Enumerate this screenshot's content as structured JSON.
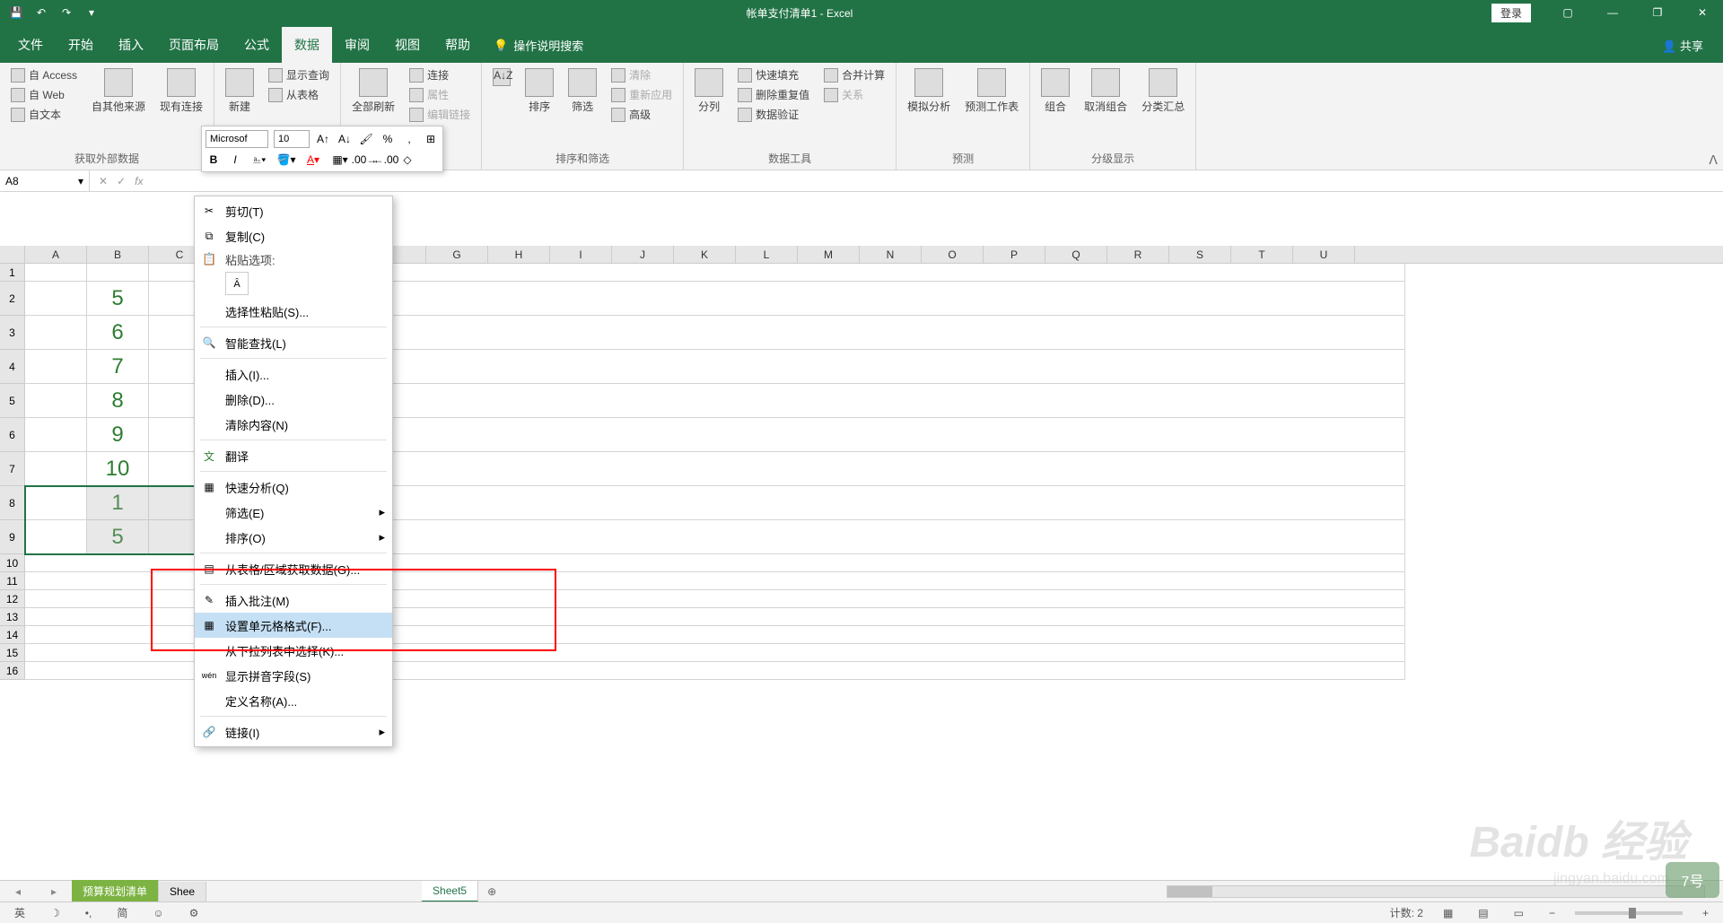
{
  "app": {
    "title": "帐单支付清单1 - Excel",
    "login": "登录"
  },
  "tabs": [
    "文件",
    "开始",
    "插入",
    "页面布局",
    "公式",
    "数据",
    "审阅",
    "视图",
    "帮助"
  ],
  "active_tab": "数据",
  "help_search": "操作说明搜索",
  "share": "共享",
  "ribbon": {
    "ext_data": {
      "access": "自 Access",
      "web": "自 Web",
      "text": "自文本",
      "other": "自其他来源",
      "existing": "现有连接",
      "label": "获取外部数据"
    },
    "get_transform": {
      "new": "新建",
      "show_query": "显示查询",
      "from_table": "从表格"
    },
    "connections": {
      "refresh": "全部刷新",
      "conn": "连接",
      "props": "属性",
      "edit_links": "编辑链接"
    },
    "sort_filter": {
      "sort": "排序",
      "filter": "筛选",
      "clear": "清除",
      "reapply": "重新应用",
      "advanced": "高级",
      "label": "排序和筛选"
    },
    "data_tools": {
      "tocol": "分列",
      "flash": "快速填充",
      "dedupe": "删除重复值",
      "validate": "数据验证",
      "consolidate": "合并计算",
      "relations": "关系",
      "label": "数据工具"
    },
    "forecast": {
      "whatif": "模拟分析",
      "forecast": "预测工作表",
      "label": "预测"
    },
    "outline": {
      "group": "组合",
      "ungroup": "取消组合",
      "subtotal": "分类汇总",
      "label": "分级显示"
    }
  },
  "mini": {
    "font": "Microsof",
    "size": "10"
  },
  "namebox": "A8",
  "columns": [
    "A",
    "B",
    "C",
    "G",
    "H",
    "I",
    "J",
    "K",
    "L",
    "M",
    "N",
    "O",
    "P",
    "Q",
    "R",
    "S",
    "T",
    "U"
  ],
  "rows_large": [
    1,
    2,
    3,
    4,
    5,
    6,
    7,
    8,
    9
  ],
  "rows_small": [
    10,
    11,
    12,
    13,
    14,
    15,
    16
  ],
  "values_b": [
    "",
    "5",
    "6",
    "7",
    "8",
    "9",
    "10",
    "1",
    "5"
  ],
  "context": {
    "cut": "剪切(T)",
    "copy": "复制(C)",
    "paste_opts": "粘贴选项:",
    "paste_special": "选择性粘贴(S)...",
    "smart_lookup": "智能查找(L)",
    "insert": "插入(I)...",
    "delete": "删除(D)...",
    "clear": "清除内容(N)",
    "translate": "翻译",
    "quick_analysis": "快速分析(Q)",
    "filter": "筛选(E)",
    "sort": "排序(O)",
    "from_table": "从表格/区域获取数据(G)...",
    "insert_comment": "插入批注(M)",
    "format_cells": "设置单元格格式(F)...",
    "dropdown": "从下拉列表中选择(K)...",
    "show_pinyin": "显示拼音字段(S)",
    "define_name": "定义名称(A)...",
    "link": "链接(I)"
  },
  "sheets": [
    "预算规划清单",
    "Shee",
    "Sheet5"
  ],
  "statusbar": {
    "count": "计数: 2",
    "zoom": "100%",
    "ime": "英",
    "ime2": "简"
  },
  "watermark": "Baidb 经验",
  "watermark_sub": "jingyan.baidu.com",
  "corner_badge": "7号",
  "chart_data": null
}
